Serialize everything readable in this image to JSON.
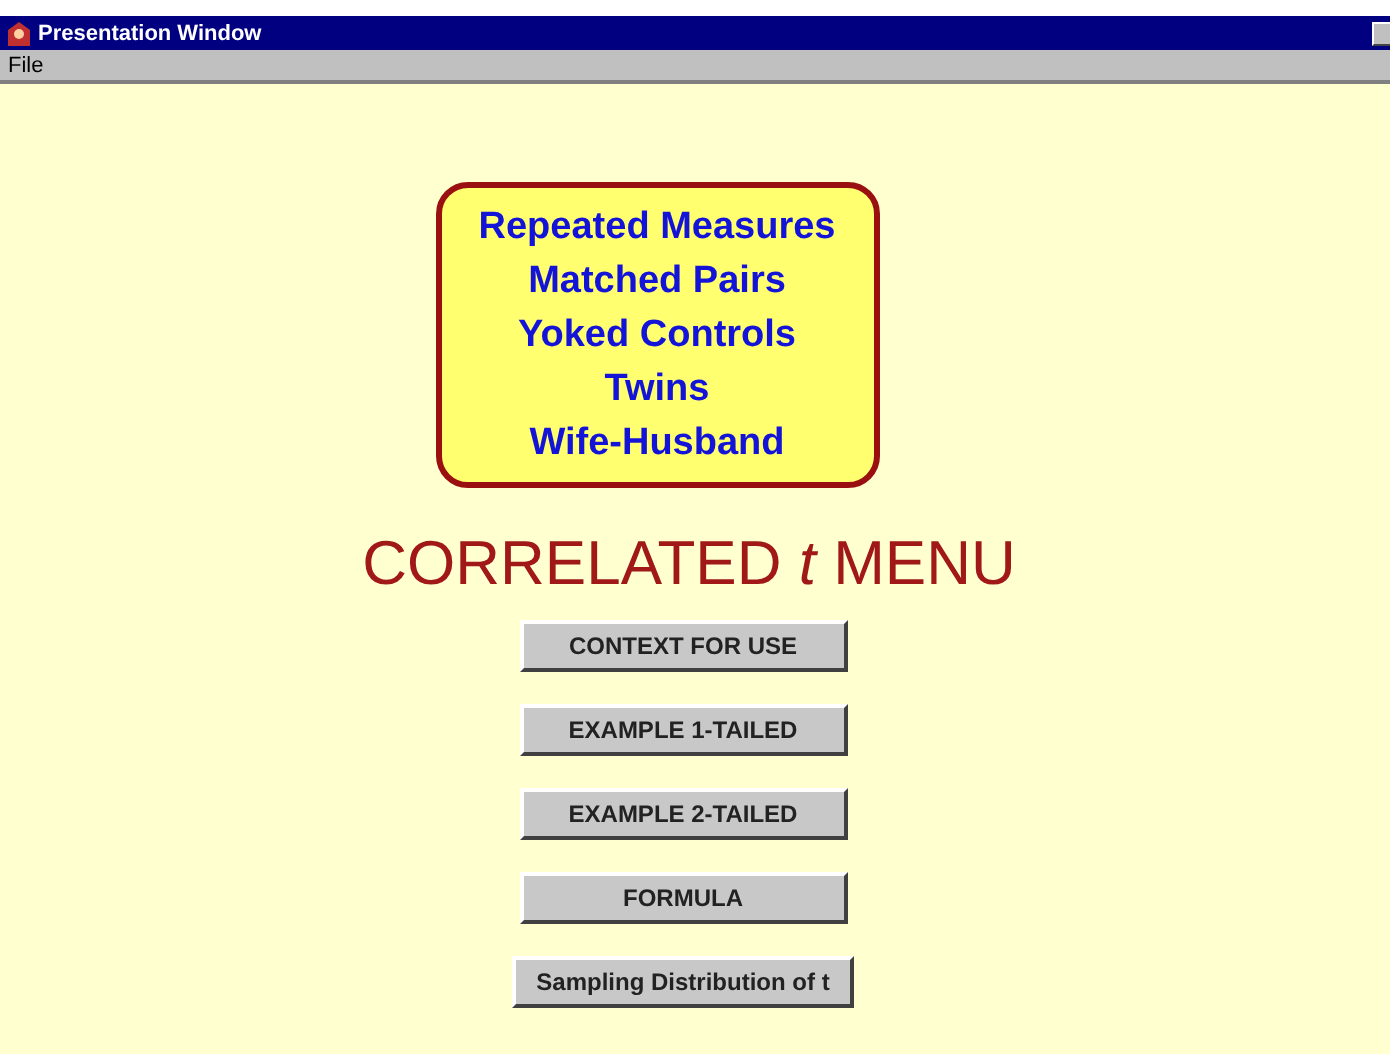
{
  "window": {
    "title": "Presentation Window"
  },
  "menu": [
    "File"
  ],
  "topics": [
    "Repeated Measures",
    "Matched Pairs",
    "Yoked Controls",
    "Twins",
    "Wife-Husband"
  ],
  "heading": "CORRELATED *t* MENU",
  "buttons": [
    "CONTEXT FOR USE",
    "EXAMPLE 1-TAILED",
    "EXAMPLE 2-TAILED",
    "FORMULA",
    "Sampling Distribution of t"
  ]
}
